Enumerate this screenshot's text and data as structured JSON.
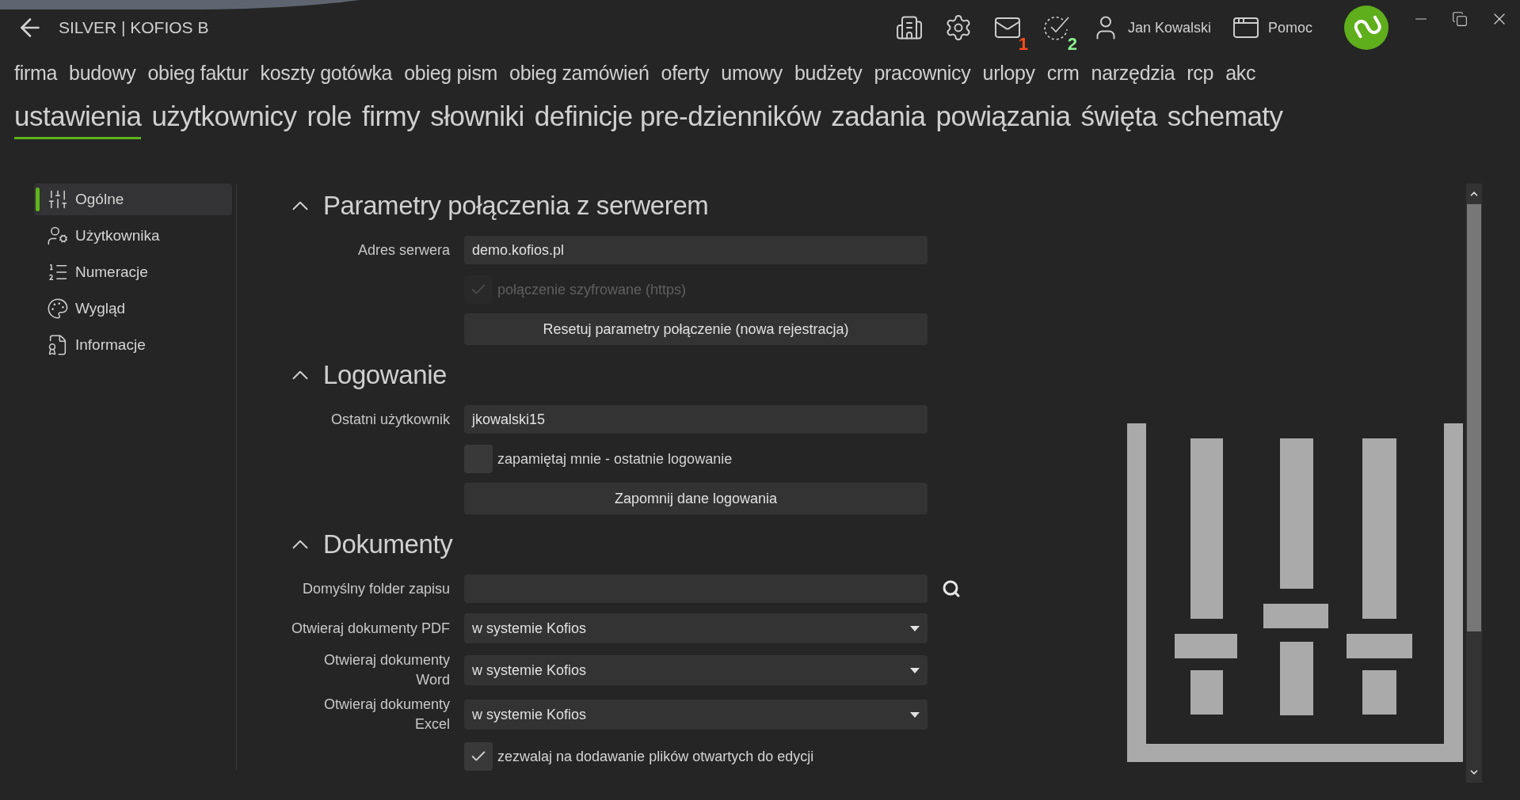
{
  "header": {
    "title": "SILVER | KOFIOS B"
  },
  "toolbar": [
    {
      "kind": "building"
    },
    {
      "kind": "gear"
    },
    {
      "kind": "mail",
      "badge": "1",
      "color": "#ff4d1c"
    },
    {
      "kind": "tasks",
      "badge": "2",
      "color": "#8ef08e"
    },
    {
      "kind": "user",
      "label": "Jan Kowalski"
    },
    {
      "kind": "help",
      "label": "Pomoc"
    }
  ],
  "modules": [
    "firma",
    "budowy",
    "obieg faktur",
    "koszty gotówka",
    "obieg pism",
    "obieg zamówień",
    "oferty",
    "umowy",
    "budżety",
    "pracownicy",
    "urlopy",
    "crm",
    "narzędzia",
    "rcp",
    "akc"
  ],
  "tabs": [
    {
      "label": "ustawienia",
      "selected": true
    },
    {
      "label": "użytkownicy",
      "selected": false
    },
    {
      "label": "role",
      "selected": false
    },
    {
      "label": "firmy",
      "selected": false
    },
    {
      "label": "słowniki",
      "selected": false
    },
    {
      "label": "definicje pre-dzienników",
      "selected": false
    },
    {
      "label": "zadania",
      "selected": false
    },
    {
      "label": "powiązania",
      "selected": false
    },
    {
      "label": "święta",
      "selected": false
    },
    {
      "label": "schematy",
      "selected": false
    }
  ],
  "sidebar": {
    "items": [
      {
        "label": "Ogólne",
        "selected": true
      },
      {
        "label": "Użytkownika",
        "selected": false
      },
      {
        "label": "Numeracje",
        "selected": false
      },
      {
        "label": "Wygląd",
        "selected": false
      },
      {
        "label": "Informacje",
        "selected": false
      }
    ]
  },
  "sections": [
    {
      "title": "Parametry połączenia z serwerem",
      "expanded": true,
      "rows": [
        {
          "kind": "field",
          "label": "Adres serwera",
          "value": "demo.kofios.pl"
        },
        {
          "kind": "checkbox",
          "label": "połączenie szyfrowane (https)",
          "checked": true,
          "disabled": true
        },
        {
          "kind": "button",
          "label": "Resetuj parametry połączenie (nowa rejestracja)"
        }
      ]
    },
    {
      "title": "Logowanie",
      "expanded": true,
      "rows": [
        {
          "kind": "field",
          "label": "Ostatni użytkownik",
          "value": "jkowalski15"
        },
        {
          "kind": "checkbox",
          "label": "zapamiętaj mnie - ostatnie logowanie",
          "checked": false,
          "disabled": false
        },
        {
          "kind": "button",
          "label": "Zapomnij dane logowania"
        }
      ]
    },
    {
      "title": "Dokumenty",
      "expanded": true,
      "rows": [
        {
          "kind": "search_field",
          "label": "Domyślny folder zapisu"
        },
        {
          "kind": "dropdown",
          "label": "Otwieraj dokumenty PDF",
          "value": "w systemie Kofios"
        },
        {
          "kind": "dropdown",
          "label": "Otwieraj dokumenty Word",
          "value": "w systemie Kofios"
        },
        {
          "kind": "dropdown",
          "label": "Otwieraj dokumenty Excel",
          "value": "w systemie Kofios"
        },
        {
          "kind": "checkbox",
          "label": "zezwalaj na dodawanie plików otwartych do edycji",
          "checked": true,
          "disabled": false
        }
      ]
    }
  ]
}
